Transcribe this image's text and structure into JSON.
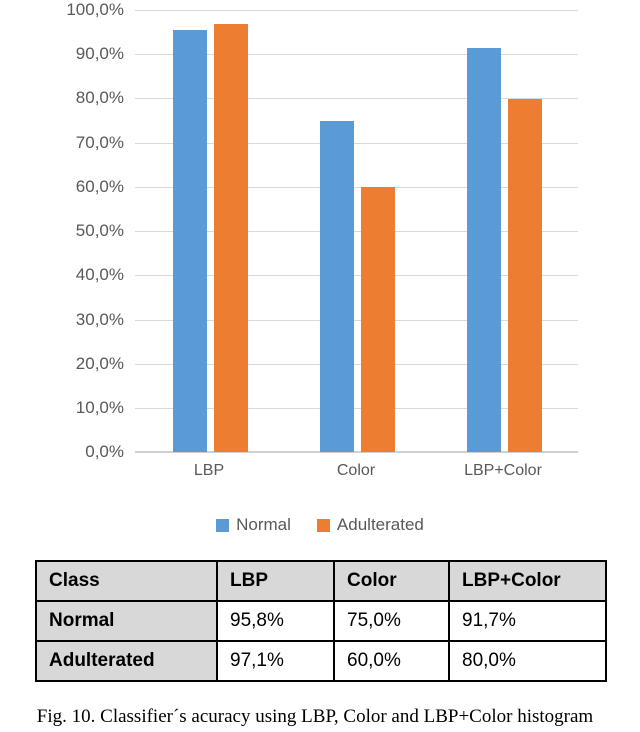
{
  "chart_data": {
    "type": "bar",
    "title": "",
    "xlabel": "",
    "ylabel": "",
    "categories": [
      "LBP",
      "Color",
      "LBP+Color"
    ],
    "series": [
      {
        "name": "Normal",
        "color": "#5B9BD5",
        "values": [
          95.8,
          75.0,
          91.7
        ]
      },
      {
        "name": "Adulterated",
        "color": "#ED7D31",
        "values": [
          97.1,
          60.0,
          80.0
        ]
      }
    ],
    "ylim": [
      0,
      100
    ],
    "ytick_values": [
      0,
      10,
      20,
      30,
      40,
      50,
      60,
      70,
      80,
      90,
      100
    ],
    "ytick_labels": [
      "0,0%",
      "10,0%",
      "20,0%",
      "30,0%",
      "40,0%",
      "50,0%",
      "60,0%",
      "70,0%",
      "80,0%",
      "90,0%",
      "100,0%"
    ],
    "grid": true,
    "legend_position": "bottom",
    "value_format": "percent-comma-decimal"
  },
  "legend": {
    "entries": [
      {
        "label": "Normal",
        "color": "#5B9BD5"
      },
      {
        "label": "Adulterated",
        "color": "#ED7D31"
      }
    ]
  },
  "table": {
    "headers": [
      "Class",
      "LBP",
      "Color",
      "LBP+Color"
    ],
    "rows": [
      {
        "class": "Normal",
        "lbp": "95,8%",
        "color": "75,0%",
        "both": "91,7%"
      },
      {
        "class": "Adulterated",
        "lbp": "97,1%",
        "color": "60,0%",
        "both": "80,0%"
      }
    ]
  },
  "caption": {
    "text": "Fig. 10. Classifier´s acuracy using LBP, Color and LBP+Color histogram"
  }
}
